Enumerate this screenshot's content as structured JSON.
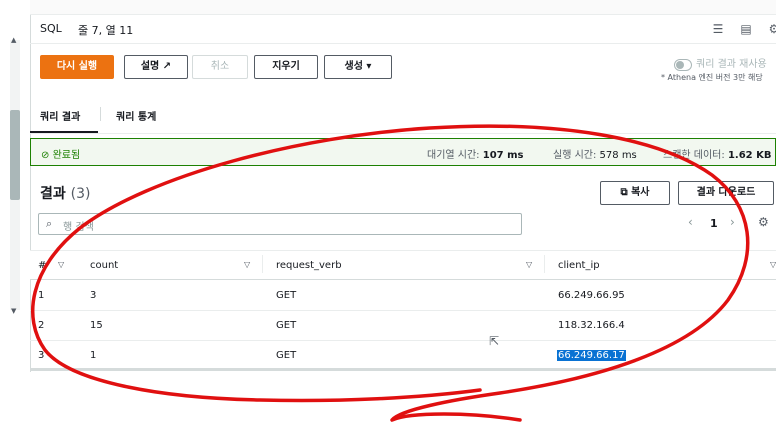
{
  "editor": {
    "language": "SQL",
    "cursor_position": "줄 7, 열 11"
  },
  "toolbar": {
    "run_again": "다시 실행",
    "explain": "설명",
    "cancel": "취소",
    "clear": "지우기",
    "create": "생성",
    "reuse_results": "쿼리 결과 재사용",
    "athena_note": "* Athena 엔진 버전 3만 해당"
  },
  "tabs": [
    {
      "label": "쿼리 결과"
    },
    {
      "label": "쿼리 통계"
    }
  ],
  "status": {
    "label": "완료됨",
    "queue_time_label": "대기열 시간:",
    "queue_time_value": "107 ms",
    "run_time_label": "실행 시간:",
    "run_time_value": "578 ms",
    "scanned_label": "스캔한 데이터:",
    "scanned_value": "1.62 KB"
  },
  "results": {
    "title": "결과",
    "count": "(3)",
    "copy": "복사",
    "download": "결과 다운로드",
    "search_placeholder": "행 검색",
    "page": "1"
  },
  "table": {
    "columns": [
      "#",
      "count",
      "request_verb",
      "client_ip"
    ],
    "rows": [
      {
        "num": "1",
        "count": "3",
        "request_verb": "GET",
        "client_ip": "66.249.66.95"
      },
      {
        "num": "2",
        "count": "15",
        "request_verb": "GET",
        "client_ip": "118.32.166.4"
      },
      {
        "num": "3",
        "count": "1",
        "request_verb": "GET",
        "client_ip": "66.249.66.17"
      }
    ]
  },
  "colors": {
    "primary": "#ec7211",
    "success": "#1d8102",
    "selection": "#0972d3",
    "annotation": "#e01010"
  }
}
